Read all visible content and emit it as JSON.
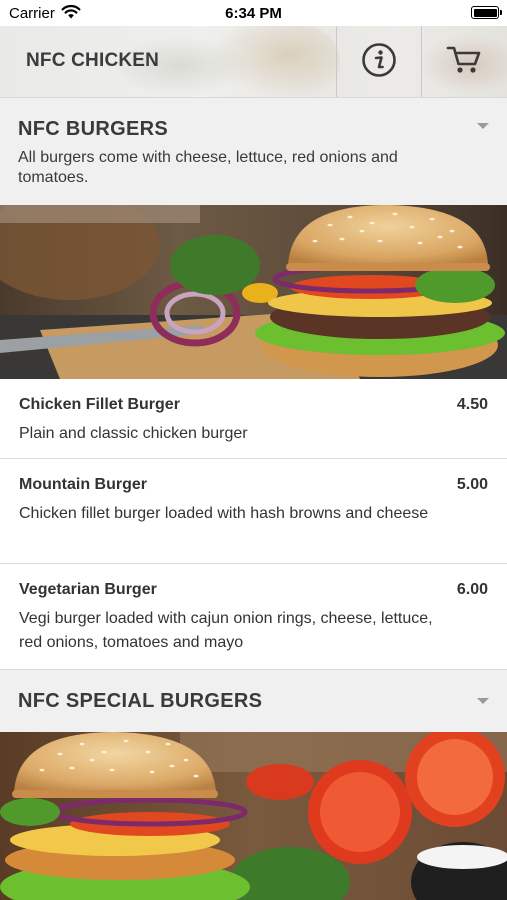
{
  "status_bar": {
    "carrier": "Carrier",
    "time": "6:34 PM"
  },
  "header": {
    "title": "NFC CHICKEN",
    "info_icon": "info-icon",
    "cart_icon": "cart-icon"
  },
  "sections": [
    {
      "title": "NFC BURGERS",
      "description": "All burgers come with cheese, lettuce, red onions and tomatoes.",
      "image": "burger-photo",
      "items": [
        {
          "name": "Chicken Fillet Burger",
          "price": "4.50",
          "description": "Plain and classic chicken burger"
        },
        {
          "name": "Mountain Burger",
          "price": "5.00",
          "description": "Chicken fillet burger loaded with hash browns and cheese"
        },
        {
          "name": "Vegetarian Burger",
          "price": "6.00",
          "description": "Vegi burger loaded with cajun onion rings, cheese, lettuce, red onions, tomatoes and mayo"
        }
      ]
    },
    {
      "title": "NFC SPECIAL BURGERS",
      "image": "special-burger-photo"
    }
  ],
  "colors": {
    "section_bg": "#f0f0f0",
    "text": "#333333",
    "divider": "#dcdcdc"
  }
}
